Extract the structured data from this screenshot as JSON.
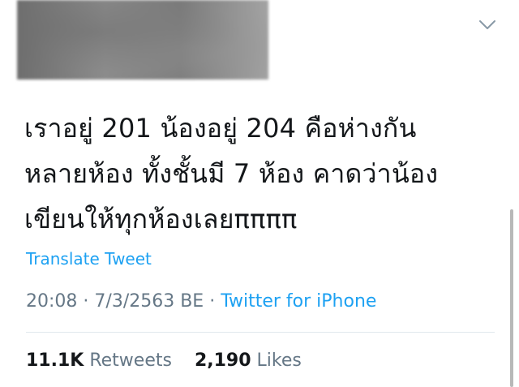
{
  "tweet": {
    "lines": [
      "เราอยู่ 201 น้องอยู่ 204 คือห่างกัน",
      "หลายห้อง ทั้งชั้นมี 7 ห้อง คาดว่าน้อง",
      "เขียนให้ทุกห้องเลยππππ"
    ],
    "translate_label": "Translate Tweet",
    "time": "20:08",
    "separator": "·",
    "date": "7/3/2563 BE",
    "source": "Twitter for iPhone"
  },
  "stats": {
    "retweets_count": "11.1K",
    "retweets_label": "Retweets",
    "likes_count": "2,190",
    "likes_label": "Likes"
  },
  "icons": {
    "menu": "chevron-down-icon"
  },
  "colors": {
    "text": "#14171a",
    "link": "#1da1f2",
    "muted": "#657786",
    "divider": "#e1e8ed"
  }
}
